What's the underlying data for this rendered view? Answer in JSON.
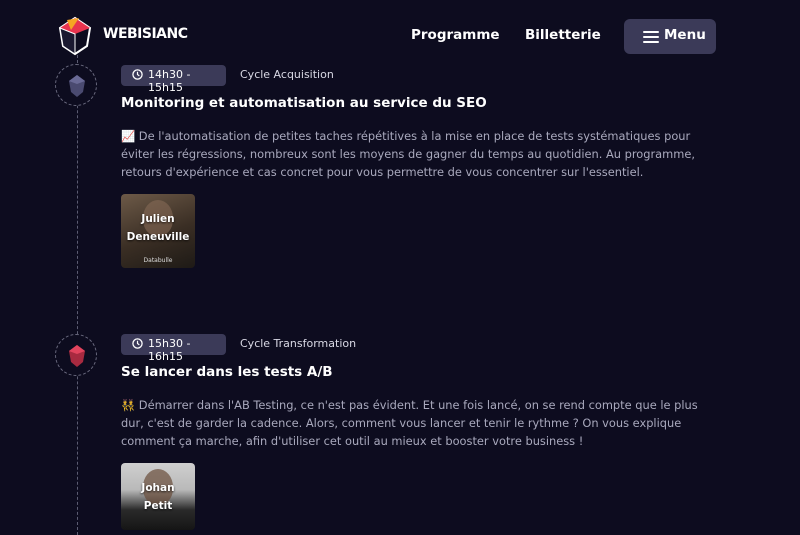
{
  "header": {
    "logo_text": "WEBISIANC",
    "nav": {
      "programme": "Programme",
      "billetterie": "Billetterie",
      "menu": "Menu"
    }
  },
  "sessions": [
    {
      "time": "14h30 - 15h15",
      "cycle": "Cycle Acquisition",
      "title": "Monitoring et automatisation au service du SEO",
      "description": "📈 De l'automatisation de petites taches répétitives à la mise en place de tests systématiques pour éviter les régressions, nombreux sont les moyens de gagner du temps au quotidien. Au programme, retours d'expérience et cas concret pour vous permettre de vous concentrer sur l'essentiel.",
      "speaker": {
        "first": "Julien",
        "last": "Deneuville",
        "company": "Databulle"
      }
    },
    {
      "time": "15h30 - 16h15",
      "cycle": "Cycle Transformation",
      "title": "Se lancer dans les tests A/B",
      "description": "👯 Démarrer dans l'AB Testing, ce n'est pas évident. Et une fois lancé, on se rend compte que le plus dur, c'est de garder la cadence. Alors, comment vous lancer et tenir le rythme ? On vous explique comment ça marche, afin d'utiliser cet outil au mieux et booster votre business !",
      "speaker": {
        "first": "Johan",
        "last": "Petit"
      }
    }
  ],
  "colors": {
    "background": "#0d0c1f",
    "badge": "#3b3a58",
    "node_icon_1": "#5a5a82",
    "node_icon_2": "#c0304a"
  },
  "icons": {
    "node_1": "gem-icon",
    "node_2": "gem-icon",
    "clock": "clock-icon",
    "menu": "hamburger-icon"
  }
}
